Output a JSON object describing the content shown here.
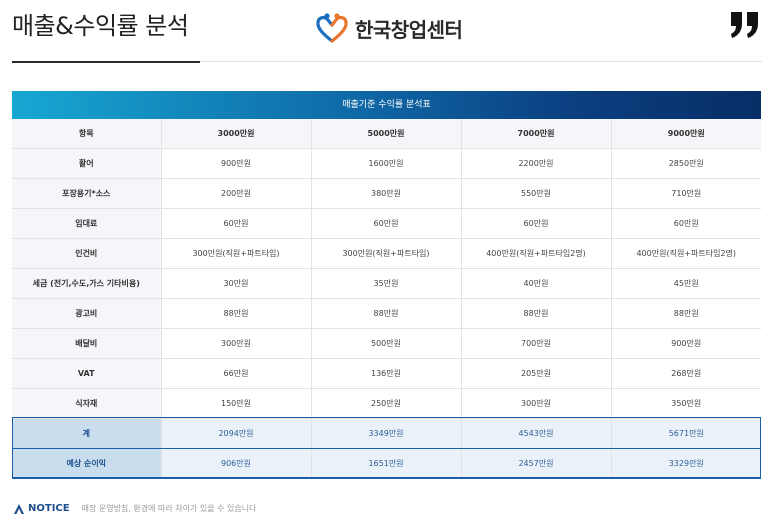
{
  "header": {
    "title": "매출&수익률 분석",
    "logo_text": "한국창업센터"
  },
  "table": {
    "title": "매출기준 수익률 분석표",
    "columns": [
      "항목",
      "3000만원",
      "5000만원",
      "7000만원",
      "9000만원"
    ],
    "rows": [
      {
        "label": "활어",
        "values": [
          "900만원",
          "1600만원",
          "2200만원",
          "2850만원"
        ]
      },
      {
        "label": "포장용기*소스",
        "values": [
          "200만원",
          "380만원",
          "550만원",
          "710만원"
        ]
      },
      {
        "label": "임대료",
        "values": [
          "60만원",
          "60만원",
          "60만원",
          "60만원"
        ]
      },
      {
        "label": "인건비",
        "values": [
          "300만원(직원+파트타임)",
          "300만원(직원+파트타임)",
          "400만원(직원+파트타임2명)",
          "400만원(직원+파트타임2명)"
        ]
      },
      {
        "label": "세금 (전기,수도,가스 기타비용)",
        "values": [
          "30만원",
          "35만원",
          "40만원",
          "45만원"
        ]
      },
      {
        "label": "광고비",
        "values": [
          "88만원",
          "88만원",
          "88만원",
          "88만원"
        ]
      },
      {
        "label": "배달비",
        "values": [
          "300만원",
          "500만원",
          "700만원",
          "900만원"
        ]
      },
      {
        "label": "VAT",
        "values": [
          "66만원",
          "136만원",
          "205만원",
          "268만원"
        ]
      },
      {
        "label": "식자재",
        "values": [
          "150만원",
          "250만원",
          "300만원",
          "350만원"
        ]
      }
    ],
    "summary": [
      {
        "label": "계",
        "values": [
          "2094만원",
          "3349만원",
          "4543만원",
          "5671만원"
        ]
      },
      {
        "label": "예상 순이익",
        "values": [
          "906만원",
          "1651만원",
          "2457만원",
          "3329만원"
        ]
      }
    ]
  },
  "notice": {
    "label": "NOTICE",
    "text": "매장 운영방침, 환경에 따라 차이가 있을 수 있습니다"
  },
  "icons": {
    "logo": "heart-people-icon",
    "quote": "quote-mark-icon",
    "notice": "triangle-icon"
  },
  "colors": {
    "accent": "#1b5ea8",
    "header_gradient_start": "#17a7d3",
    "header_gradient_end": "#082e66",
    "summary_label_bg": "#c9ddef"
  }
}
